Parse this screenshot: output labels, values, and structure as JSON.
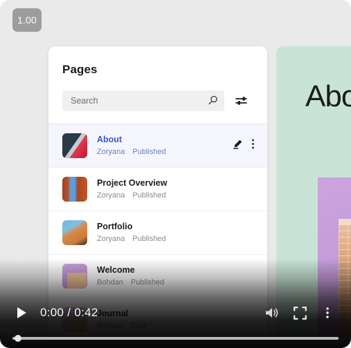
{
  "overlay": {
    "scale_badge": "1.00"
  },
  "panel": {
    "title": "Pages",
    "search": {
      "placeholder": "Search",
      "value": ""
    },
    "filter_icon": "tune-icon",
    "search_icon": "search-icon"
  },
  "pages": [
    {
      "title": "About",
      "author": "Zoryana",
      "status": "Published",
      "selected": true,
      "thumb": "about-thumb"
    },
    {
      "title": "Project Overview",
      "author": "Zoryana",
      "status": "Published",
      "selected": false,
      "thumb": "canyon-thumb"
    },
    {
      "title": "Portfolio",
      "author": "Zoryana",
      "status": "Published",
      "selected": false,
      "thumb": "dune-thumb"
    },
    {
      "title": "Welcome",
      "author": "Bohdan",
      "status": "Published",
      "selected": false,
      "thumb": "room-thumb"
    },
    {
      "title": "Journal",
      "author": "Bohdan",
      "status": "Draft",
      "selected": false,
      "thumb": "journal-thumb"
    }
  ],
  "row_actions": {
    "edit_icon": "pencil-icon",
    "more_icon": "more-vertical-icon"
  },
  "preview": {
    "heading": "Abo"
  },
  "video": {
    "play_label": "play-icon",
    "time": "0:00 / 0:42",
    "volume_icon": "volume-icon",
    "fullscreen_icon": "fullscreen-icon",
    "more_icon": "more-vertical-icon",
    "progress_percent": 1
  },
  "colors": {
    "accent_blue": "#3a56d4",
    "panel_bg": "#ffffff",
    "app_bg": "#eaeaea",
    "preview_mint": "#c9e4d6",
    "selected_row": "#f5f6fd",
    "badge_grey": "#9d9d9d"
  }
}
